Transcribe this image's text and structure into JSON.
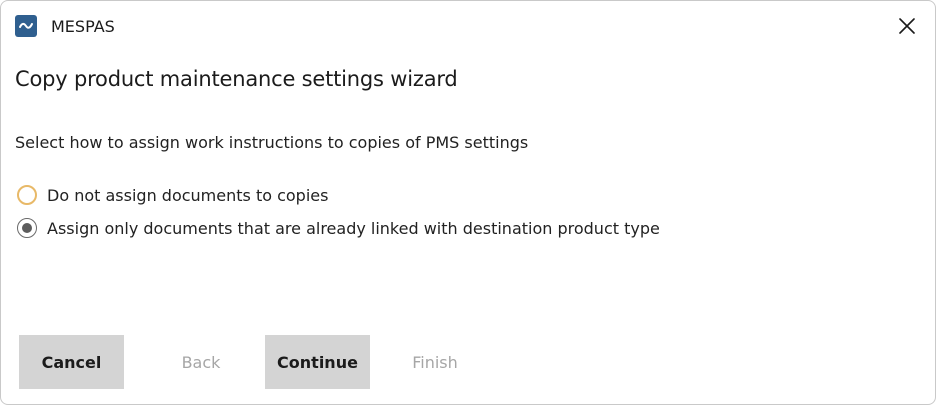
{
  "window": {
    "app_name": "MESPAS",
    "logo_icon": "mespas-logo-icon",
    "close_icon": "close-icon"
  },
  "wizard": {
    "title": "Copy product maintenance settings wizard",
    "instruction": "Select how to assign work instructions to copies of PMS settings",
    "options": [
      {
        "label": "Do not assign documents to copies",
        "selected": false
      },
      {
        "label": "Assign only documents that are already linked with destination product type",
        "selected": true
      }
    ]
  },
  "buttons": {
    "cancel": {
      "label": "Cancel",
      "enabled": true
    },
    "back": {
      "label": "Back",
      "enabled": false
    },
    "continue": {
      "label": "Continue",
      "enabled": true
    },
    "finish": {
      "label": "Finish",
      "enabled": false
    }
  },
  "colors": {
    "logo_bg": "#2f5f8f",
    "button_bg": "#d4d4d4",
    "disabled_text": "#a6a6a6",
    "focus_radio_border": "#e8b968"
  }
}
